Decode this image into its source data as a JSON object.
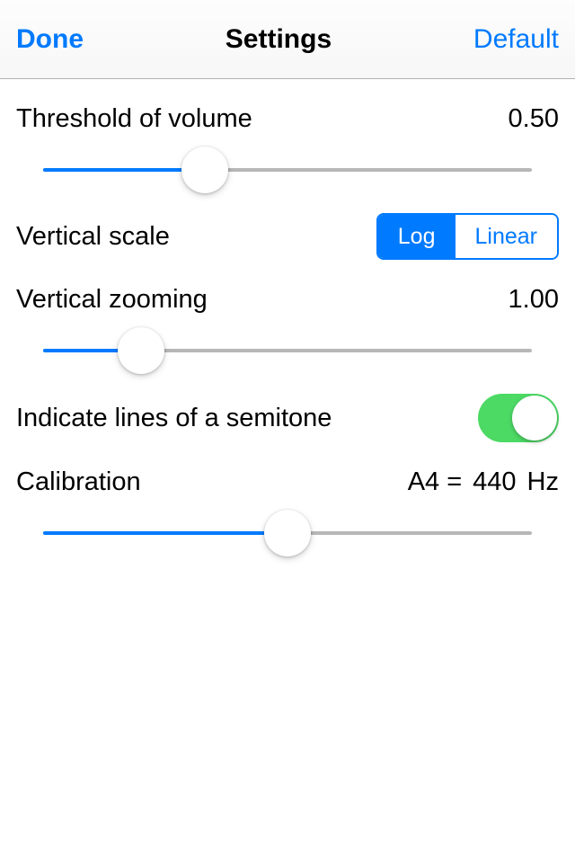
{
  "navbar": {
    "done": "Done",
    "title": "Settings",
    "default": "Default"
  },
  "threshold": {
    "label": "Threshold of volume",
    "value": "0.50",
    "slider_percent": 33
  },
  "vertical_scale": {
    "label": "Vertical scale",
    "options": [
      "Log",
      "Linear"
    ],
    "selected_index": 0
  },
  "vertical_zooming": {
    "label": "Vertical zooming",
    "value": "1.00",
    "slider_percent": 20
  },
  "semitone": {
    "label": "Indicate lines of a semitone",
    "on": true
  },
  "calibration": {
    "label": "Calibration",
    "prefix": "A4 =",
    "value": "440",
    "unit": "Hz",
    "slider_percent": 50
  },
  "colors": {
    "accent": "#007aff",
    "switch_on": "#4cd964"
  }
}
